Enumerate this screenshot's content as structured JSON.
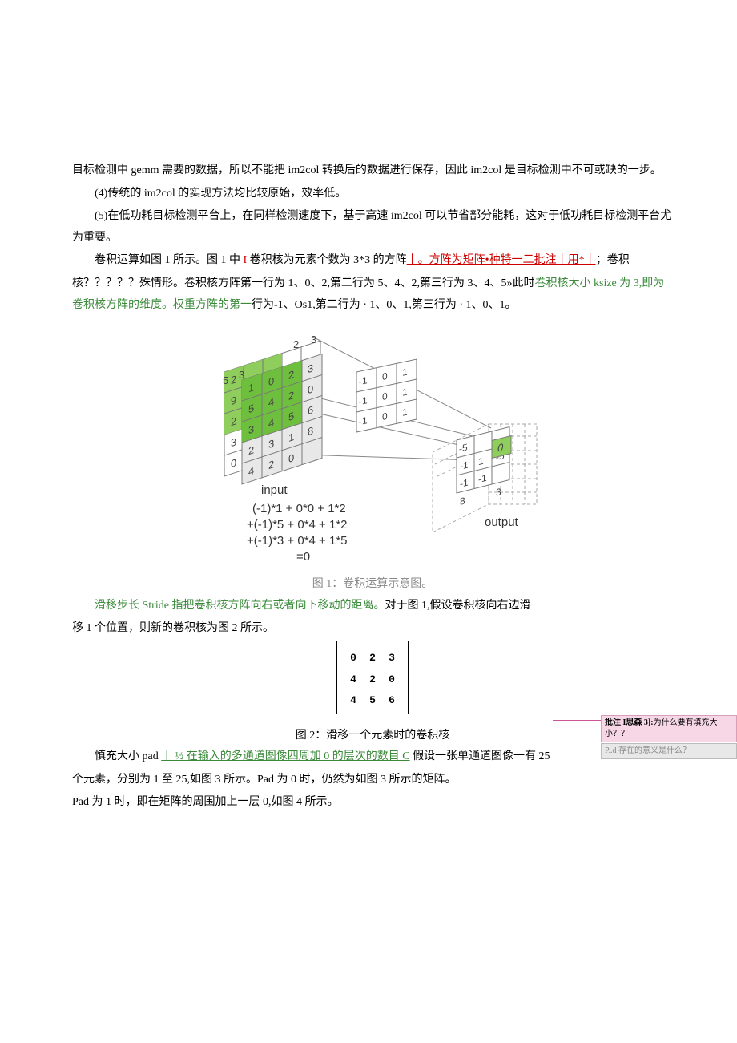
{
  "paragraphs": {
    "p1_a": "目标检测中 gemm 需要的数据，所以不能把 im2col 转换后的数据进行保存，因此 im2col 是目标检测中不可或缺的一步。",
    "p2_a": "(4)传统的 im2col 的实现方法均比较原始，效率低。",
    "p3_a": "(5)在低功耗目标检测平台上，在同样检测速度下，基于高速 im2col 可以节省部分能耗，这对于低功耗目标检测平台尤为重要。",
    "p4_a": "卷积运算如图 1 所示。图 1 中 ",
    "p4_b_red": "I",
    "p4_c": " 卷积核为元素个数为 3*3 的方阵",
    "p4_d_under": "丨。方阵为矩阵•种特一二批注丨用*丨",
    "p4_e": "；卷积",
    "p5_a": "核？？？？？殊情形。卷积核方阵第一行为 1、0、2,第二行为 5、4、2,第三行为 3、4、5»此时",
    "p5_b_green": "卷积核大小 ksize 为 3,即为卷积核方阵的维度。权重方阵的第一",
    "p5_c": "行为-1、Os1,第二行为 · 1、0、1,第三行为 · 1、0、1。",
    "p7_a_green": "滑移步长 Stride 指把卷积核方阵向右或者向下移动的距离。",
    "p7_b": "对于图 1,假设卷积核向右边滑",
    "p8": "移 1 个位置，则新的卷积核为图 2 所示。",
    "p9_a": "慎充大小 pad ",
    "p9_b_under": "丨 ½ 在输入的多通道图像四周加 0 的层次的数目 C",
    "p9_c": " 假设一张单通道图像一有 25",
    "p10": "个元素，分别为 1 至 25,如图 3 所示。Pad 为 0 时，仍然为如图 3 所示的矩阵。",
    "p11": "Pad 为 1 时，即在矩阵的周围加上一层 0,如图 4 所示。"
  },
  "figure1_caption": "图 1：卷积运算示意图。",
  "figure2_caption": "图 2：滑移一个元素时的卷积核",
  "figure1": {
    "input_label": "input",
    "output_label": "output",
    "math_lines": [
      "(-1)*1 + 0*0 + 1*2",
      "+(-1)*5 + 0*4 + 1*2",
      "+(-1)*3 + 0*4 + 1*5",
      "=0"
    ],
    "input_top_back": [
      2,
      3,
      2,
      9,
      5,
      2,
      4,
      3,
      2,
      0,
      4
    ],
    "input_front": [
      [
        1,
        0,
        2,
        3
      ],
      [
        5,
        4,
        2,
        0
      ],
      [
        3,
        4,
        5,
        6
      ],
      [
        2,
        3,
        1,
        8
      ],
      [
        4,
        2,
        0,
        ""
      ]
    ],
    "kernel": [
      [
        -1,
        0,
        1
      ],
      [
        -1,
        0,
        1
      ],
      [
        -1,
        0,
        1
      ]
    ],
    "output_back_vals": [
      "-5",
      0,
      1,
      "-5",
      -1,
      -1,
      8,
      3
    ],
    "output_front_vals": [
      0
    ]
  },
  "figure2_table": [
    [
      "0",
      "2",
      "3"
    ],
    [
      "4",
      "2",
      "0"
    ],
    [
      "4",
      "5",
      "6"
    ]
  ],
  "comment": {
    "line1_label": "批注 I思森 3]:",
    "line1_text": "为什么要有填充大小？？",
    "line2": "P..d 存在的意义是什么？"
  }
}
